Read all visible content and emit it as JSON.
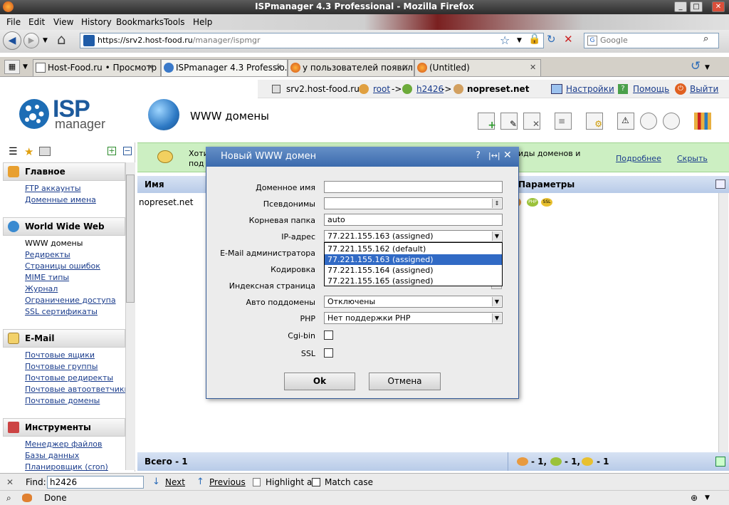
{
  "window": {
    "title": "ISPmanager 4.3 Professional - Mozilla Firefox"
  },
  "menu": [
    "File",
    "Edit",
    "View",
    "History",
    "Bookmarks",
    "Tools",
    "Help"
  ],
  "nav": {
    "url_prefix": "https://srv2.",
    "url_host": "host-food.ru",
    "url_path": "/manager/ispmgr",
    "search_placeholder": "Google"
  },
  "tabs": [
    {
      "label": "Host-Food.ru • Просмотр ..."
    },
    {
      "label": "ISPmanager 4.3 Professio..."
    },
    {
      "label": "у пользователей появил..."
    },
    {
      "label": "(Untitled)"
    }
  ],
  "header": {
    "server": "srv2.host-food.ru ::",
    "crumb1": "root",
    "sep": "->",
    "crumb2": "h2426",
    "crumb3": "nopreset.net",
    "settings": "Настройки",
    "help": "Помощь",
    "logout": "Выйти",
    "logo_isp": "ISP",
    "logo_manager": "manager",
    "page_title": "WWW домены"
  },
  "sidebar": {
    "sections": [
      {
        "title": "Главное",
        "items": [
          "FTP аккаунты",
          "Доменные имена"
        ]
      },
      {
        "title": "World Wide Web",
        "items": [
          "WWW домены",
          "Редиректы",
          "Страницы ошибок",
          "MIME типы",
          "Журнал",
          "Ограничение доступа",
          "SSL сертификаты"
        ]
      },
      {
        "title": "E-Mail",
        "items": [
          "Почтовые ящики",
          "Почтовые группы",
          "Почтовые редиректы",
          "Почтовые автоответчики",
          "Почтовые домены"
        ]
      },
      {
        "title": "Инструменты",
        "items": [
          "Менеджер файлов",
          "Базы данных",
          "Планировщик (cron)"
        ]
      }
    ]
  },
  "notice": {
    "text_left": "Хоти",
    "text_left2": "под",
    "text_right": "иды доменов и",
    "more": "Подробнее",
    "hide": "Скрыть"
  },
  "table": {
    "col_name": "Имя",
    "col_params": "Параметры",
    "row_name": "nopreset.net",
    "total": "Всего - 1",
    "count1": "- 1,",
    "count2": "- 1,",
    "count3": "- 1"
  },
  "modal": {
    "title": "Новый WWW домен",
    "fields": {
      "domain": {
        "label": "Доменное имя",
        "value": ""
      },
      "aliases": {
        "label": "Псевдонимы",
        "value": ""
      },
      "root": {
        "label": "Корневая папка",
        "value": "auto"
      },
      "ip": {
        "label": "IP-адрес",
        "value": "77.221.155.163 (assigned)"
      },
      "email": {
        "label": "E-Mail администратора"
      },
      "encoding": {
        "label": "Кодировка"
      },
      "index": {
        "label": "Индексная страница"
      },
      "autosub": {
        "label": "Авто поддомены",
        "value": "Отключены"
      },
      "php": {
        "label": "PHP",
        "value": "Нет поддержки PHP"
      },
      "cgi": {
        "label": "Cgi-bin"
      },
      "ssl": {
        "label": "SSL"
      }
    },
    "ip_options": [
      "77.221.155.162 (default)",
      "77.221.155.163 (assigned)",
      "77.221.155.164 (assigned)",
      "77.221.155.165 (assigned)"
    ],
    "ok": "Ok",
    "cancel": "Отмена"
  },
  "findbar": {
    "label": "Find:",
    "value": "h2426",
    "next": "Next",
    "previous": "Previous",
    "highlight": "Highlight all",
    "match": "Match case"
  },
  "status": {
    "text": "Done"
  },
  "colors": {
    "accent": "#316ac5",
    "modal_title": "#3b6aad",
    "notice": "#ccefc2",
    "link": "#1a3c8c"
  }
}
